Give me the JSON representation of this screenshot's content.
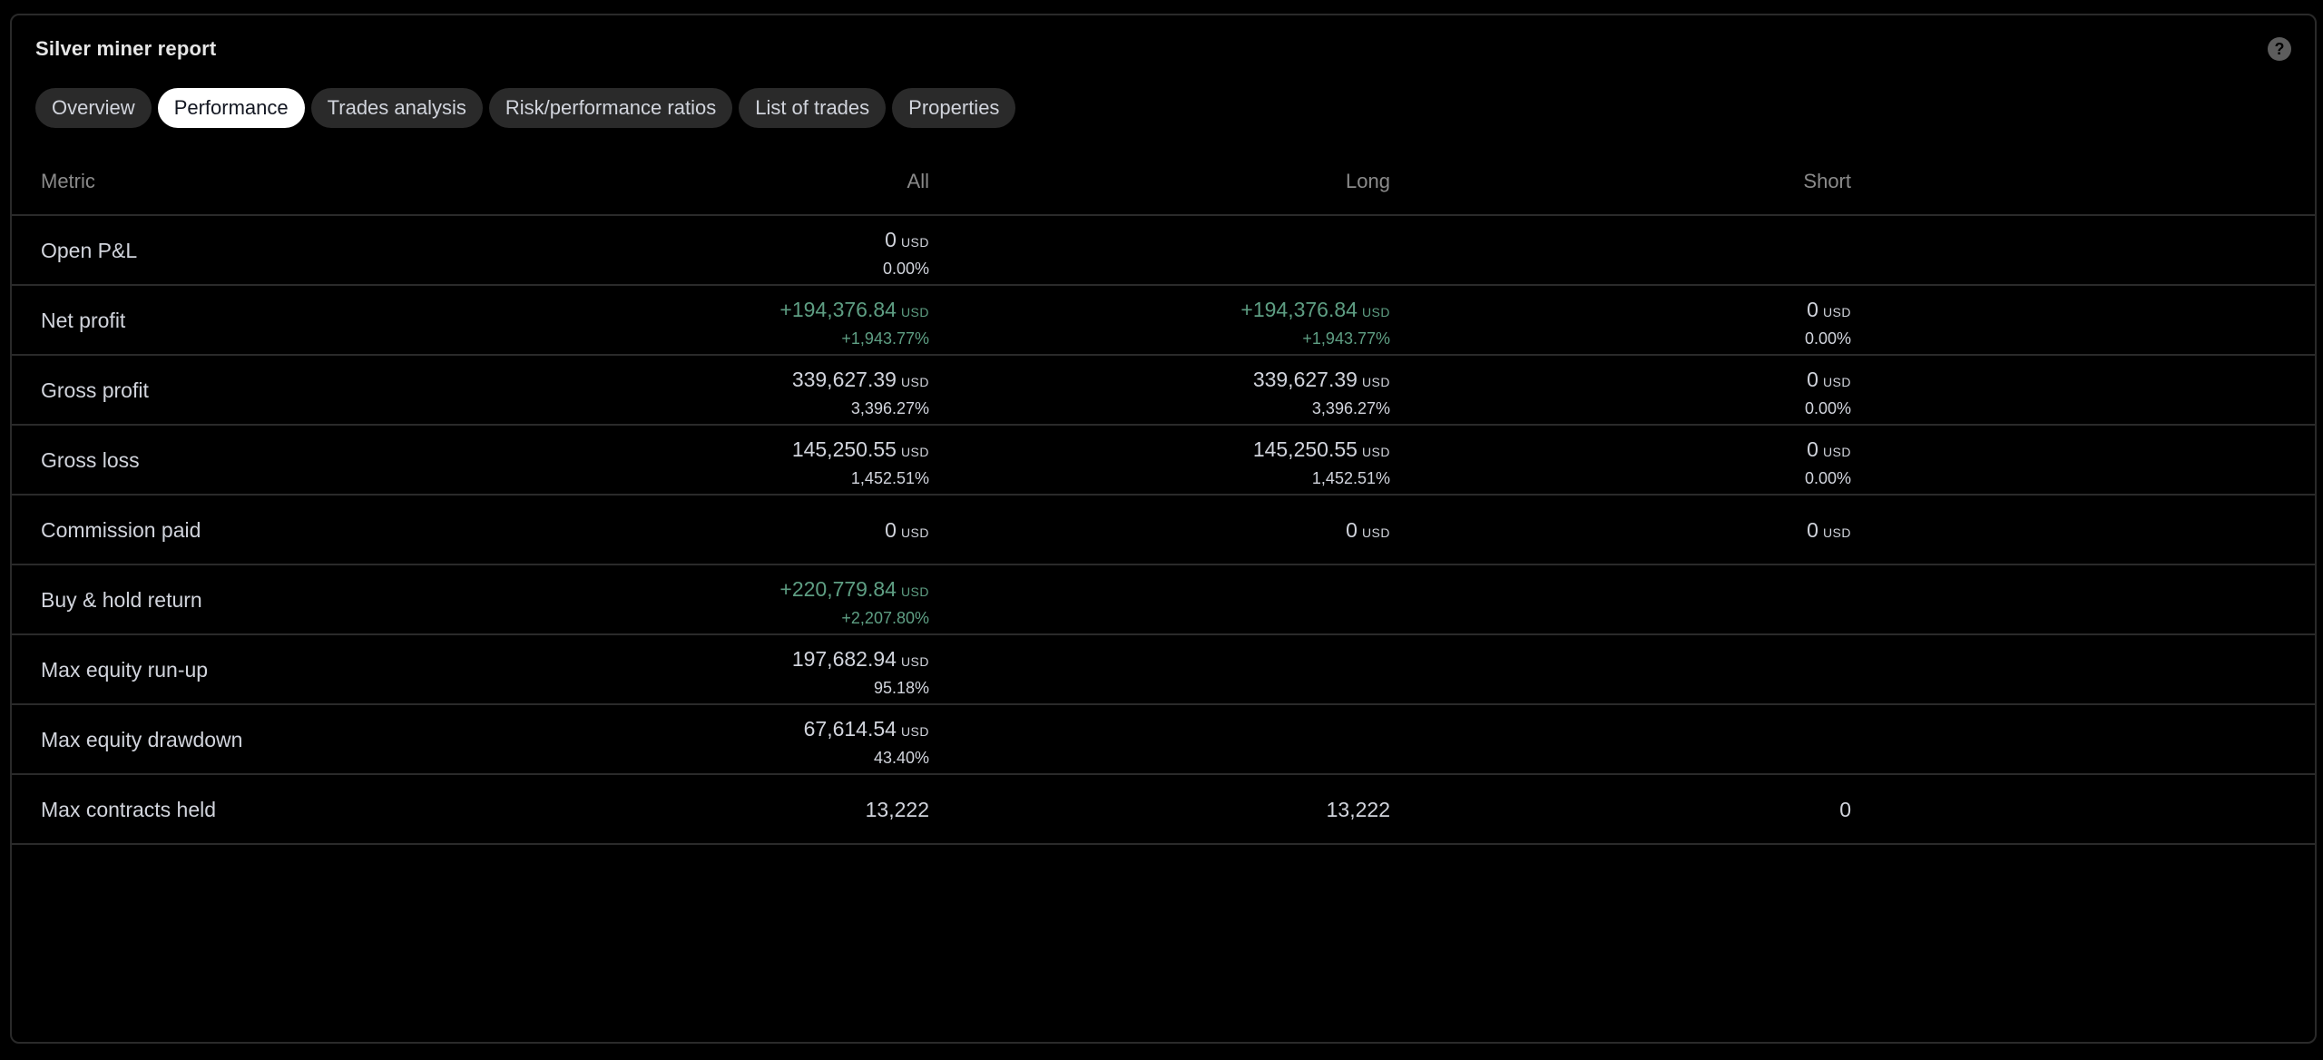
{
  "report": {
    "title": "Silver miner report",
    "help_icon": "question-circle-icon",
    "help_glyph": "?"
  },
  "tabs": [
    {
      "label": "Overview",
      "active": false
    },
    {
      "label": "Performance",
      "active": true
    },
    {
      "label": "Trades analysis",
      "active": false
    },
    {
      "label": "Risk/performance ratios",
      "active": false
    },
    {
      "label": "List of trades",
      "active": false
    },
    {
      "label": "Properties",
      "active": false
    }
  ],
  "table": {
    "headers": {
      "metric": "Metric",
      "all": "All",
      "long": "Long",
      "short": "Short"
    },
    "unit": "USD",
    "rows": [
      {
        "metric": "Open P&L",
        "all": {
          "value": "0",
          "unit": "USD",
          "pct": "0.00%"
        }
      },
      {
        "metric": "Net profit",
        "all": {
          "value": "+194,376.84",
          "unit": "USD",
          "pct": "+1,943.77%",
          "positive": true
        },
        "long": {
          "value": "+194,376.84",
          "unit": "USD",
          "pct": "+1,943.77%",
          "positive": true
        },
        "short": {
          "value": "0",
          "unit": "USD",
          "pct": "0.00%"
        }
      },
      {
        "metric": "Gross profit",
        "all": {
          "value": "339,627.39",
          "unit": "USD",
          "pct": "3,396.27%"
        },
        "long": {
          "value": "339,627.39",
          "unit": "USD",
          "pct": "3,396.27%"
        },
        "short": {
          "value": "0",
          "unit": "USD",
          "pct": "0.00%"
        }
      },
      {
        "metric": "Gross loss",
        "all": {
          "value": "145,250.55",
          "unit": "USD",
          "pct": "1,452.51%"
        },
        "long": {
          "value": "145,250.55",
          "unit": "USD",
          "pct": "1,452.51%"
        },
        "short": {
          "value": "0",
          "unit": "USD",
          "pct": "0.00%"
        }
      },
      {
        "metric": "Commission paid",
        "all": {
          "value": "0",
          "unit": "USD"
        },
        "long": {
          "value": "0",
          "unit": "USD"
        },
        "short": {
          "value": "0",
          "unit": "USD"
        }
      },
      {
        "metric": "Buy & hold return",
        "all": {
          "value": "+220,779.84",
          "unit": "USD",
          "pct": "+2,207.80%",
          "positive": true
        }
      },
      {
        "metric": "Max equity run-up",
        "all": {
          "value": "197,682.94",
          "unit": "USD",
          "pct": "95.18%"
        }
      },
      {
        "metric": "Max equity drawdown",
        "all": {
          "value": "67,614.54",
          "unit": "USD",
          "pct": "43.40%"
        }
      },
      {
        "metric": "Max contracts held",
        "all": {
          "value": "13,222"
        },
        "long": {
          "value": "13,222"
        },
        "short": {
          "value": "0"
        }
      }
    ]
  },
  "colors": {
    "positive": "#5e9e83",
    "text": "#d1d4dc",
    "muted": "#8a8a8a",
    "tab_bg": "#2a2a2a",
    "tab_active_bg": "#ffffff",
    "border": "#2a2a2a"
  }
}
